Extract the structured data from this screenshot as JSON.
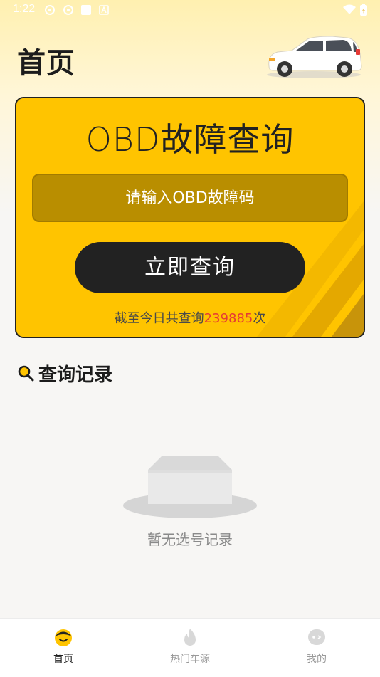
{
  "status_bar": {
    "time": "1:22"
  },
  "header": {
    "title": "首页"
  },
  "query_card": {
    "title": "OBD故障查询",
    "input_placeholder": "请输入OBD故障码",
    "button_label": "立即查询",
    "count_prefix": "截至今日共查询",
    "count_value": "239885",
    "count_suffix": "次"
  },
  "history": {
    "title": "查询记录",
    "empty_text": "暂无选号记录"
  },
  "tab_bar": {
    "tabs": [
      {
        "label": "首页",
        "icon": "home-face-icon",
        "active": true
      },
      {
        "label": "热门车源",
        "icon": "flame-icon",
        "active": false
      },
      {
        "label": "我的",
        "icon": "profile-face-icon",
        "active": false
      }
    ]
  },
  "colors": {
    "accent": "#ffc400",
    "input_bg": "#b98e00",
    "count_highlight": "#e53935",
    "button_bg": "#222222"
  }
}
